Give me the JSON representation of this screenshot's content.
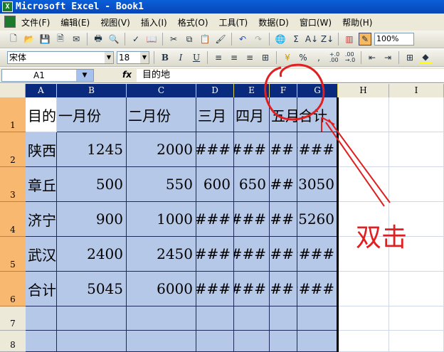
{
  "window": {
    "title": "Microsoft Excel - Book1"
  },
  "menu": [
    "文件(F)",
    "编辑(E)",
    "视图(V)",
    "插入(I)",
    "格式(O)",
    "工具(T)",
    "数据(D)",
    "窗口(W)",
    "帮助(H)"
  ],
  "toolbar": {
    "zoom": "100%",
    "font": "宋体",
    "font_size": "18",
    "bold": "B",
    "italic": "I",
    "underline": "U",
    "percent": "%",
    "comma": ",",
    "inc_decimal": "+.0\n.00",
    "dec_decimal": ".00\n→.0"
  },
  "formula_bar": {
    "name_box": "A1",
    "fx": "fx",
    "value": "目的地"
  },
  "columns": [
    "A",
    "B",
    "C",
    "D",
    "E",
    "F",
    "G",
    "H",
    "I"
  ],
  "rows": [
    "1",
    "2",
    "3",
    "4",
    "5",
    "6",
    "7",
    "8"
  ],
  "cells": [
    [
      "目的地",
      "一月份",
      "二月份",
      "三月",
      "四月",
      "五月",
      "合计"
    ],
    [
      "陕西",
      "1245",
      "2000",
      "###",
      "###",
      "##",
      "####"
    ],
    [
      "章丘",
      "500",
      "550",
      "600",
      "650",
      "##",
      "3050"
    ],
    [
      "济宁",
      "900",
      "1000",
      "###",
      "###",
      "##",
      "5260"
    ],
    [
      "武汉",
      "2400",
      "2450",
      "###",
      "###",
      "##",
      "####"
    ],
    [
      "合计",
      "5045",
      "6000",
      "###",
      "###",
      "##",
      "####"
    ]
  ],
  "annotation": "双击",
  "colors": {
    "annotation": "#e02020",
    "selection": "#b6c8e8",
    "header_selected": "#0a2a7e"
  }
}
